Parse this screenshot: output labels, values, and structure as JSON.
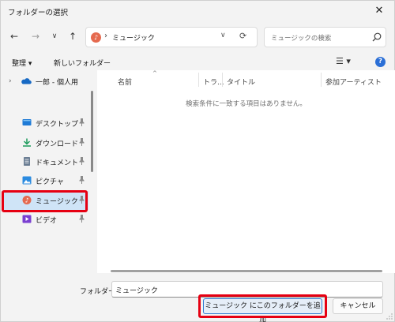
{
  "window": {
    "title": "フォルダーの選択",
    "close_glyph": "✕"
  },
  "nav_buttons": {
    "back": "←",
    "forward": "→",
    "recent": "∨",
    "up": "↑"
  },
  "address": {
    "separator": "›",
    "path": "ミュージック",
    "dropdown": "∨",
    "refresh": "⟳"
  },
  "search": {
    "placeholder": "ミュージックの検索"
  },
  "command_bar": {
    "organize": "整理 ▾",
    "new_folder": "新しいフォルダー",
    "view": "☰ ▾",
    "help": "?"
  },
  "navigation": {
    "onedrive": {
      "chevron": "›",
      "label": "一郎 - 個人用"
    },
    "items": [
      {
        "label": "デスクトップ",
        "icon": "desktop-icon",
        "color": "#1f7bd6"
      },
      {
        "label": "ダウンロード",
        "icon": "download-icon",
        "color": "#1a9a5a"
      },
      {
        "label": "ドキュメント",
        "icon": "document-icon",
        "color": "#6a7d93"
      },
      {
        "label": "ピクチャ",
        "icon": "picture-icon",
        "color": "#2b8be0"
      },
      {
        "label": "ミュージック",
        "icon": "music-icon",
        "color": "#e56a4f",
        "selected": true
      },
      {
        "label": "ビデオ",
        "icon": "video-icon",
        "color": "#7a3fd1"
      }
    ]
  },
  "columns": [
    "名前",
    "トラ...",
    "タイトル",
    "参加アーティスト"
  ],
  "empty_message": "検索条件に一致する項目はありません。",
  "footer": {
    "folder_label": "フォルダー:",
    "folder_value": "ミュージック",
    "primary_button": "ミュージック にこのフォルダーを追加",
    "cancel_button": "キャンセル"
  },
  "colors": {
    "highlight": "#e60012",
    "selection": "#cfe4f7",
    "accent": "#2f7ad0"
  }
}
